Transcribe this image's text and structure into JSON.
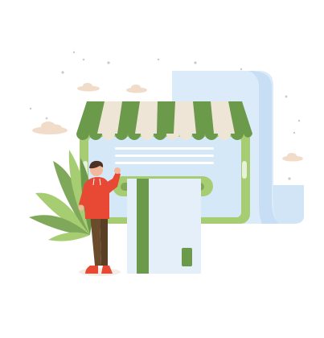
{
  "illustration": {
    "subject": "online-shop-card-payment",
    "elements": {
      "storefront": "storefront-tablet",
      "awning": "striped-awning",
      "receipt": "paper-receipt",
      "card": "payment-card",
      "person": "person-waving",
      "plant": "leafy-plant",
      "clouds": "clouds",
      "sparkles": "sparkle-dots"
    },
    "colors": {
      "green_dark": "#6b9a4a",
      "green_light": "#a7cd73",
      "green_mid": "#7fa85a",
      "cream": "#efe5d6",
      "screen_blue": "#d4e8f7",
      "receipt_blue": "#dcebf9",
      "card_bg": "#e4eff9",
      "shirt_red": "#e84935",
      "pants_brown": "#6a4b2b",
      "skin": "#f4b99a",
      "hair": "#4a3325",
      "cloud": "#f0dcc8",
      "dots": "#c9c9c9"
    }
  }
}
